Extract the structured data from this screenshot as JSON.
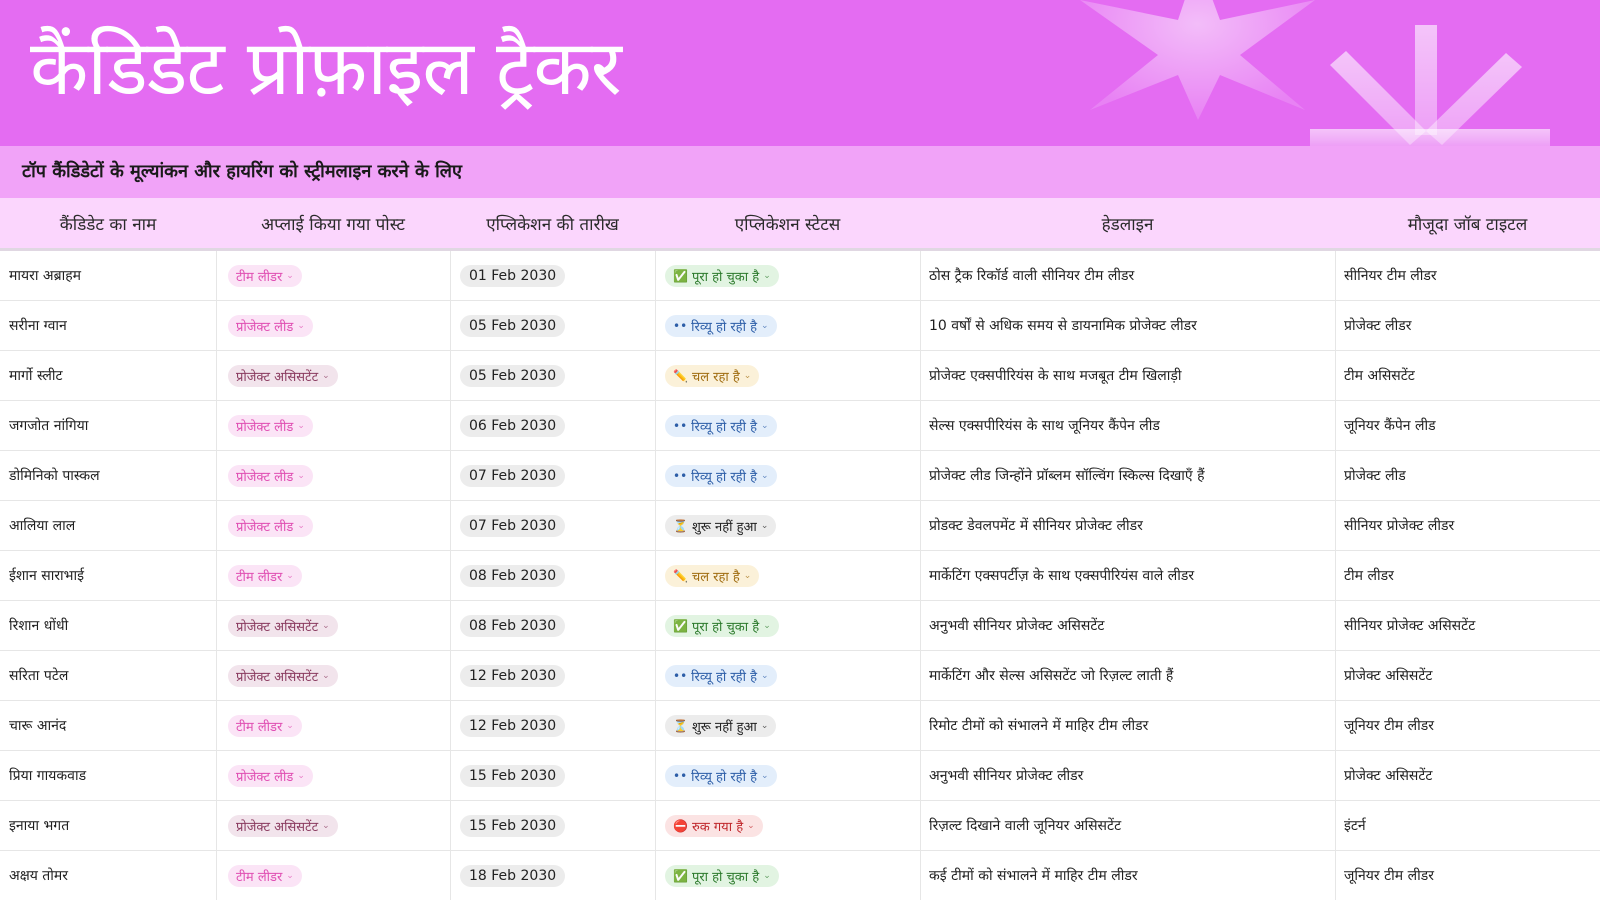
{
  "header": {
    "title": "कैंडिडेट प्रोफ़ाइल ट्रैकर",
    "subtitle": "टॉप कैंडिडेटों के मूल्यांकन और हायरिंग को स्ट्रीमलाइन करने के लिए"
  },
  "colors": {
    "banner": "#e46cf2",
    "subtitle_bar": "#f1a3f8",
    "header_row": "#fbd6fd"
  },
  "columns": [
    "कैंडिडेट का नाम",
    "अप्लाई किया गया पोस्ट",
    "एप्लिकेशन की तारीख",
    "एप्लिकेशन स्टेटस",
    "हेडलाइन",
    "मौजूदा जॉब टाइटल"
  ],
  "status_icons": {
    "done": "check-icon",
    "review": "eyes-icon",
    "progress": "pencil-icon",
    "notstarted": "hourglass-icon",
    "stopped": "no-entry-icon"
  },
  "rows": [
    {
      "name": "मायरा अब्राहम",
      "post": "टीम लीडर",
      "post_type": "team",
      "date": "01 Feb 2030",
      "status": "पूरा हो चुका है",
      "status_type": "done",
      "headline": "ठोस ट्रैक रिकॉर्ड वाली सीनियर टीम लीडर",
      "title": "सीनियर टीम लीडर"
    },
    {
      "name": "सरीना ग्वान",
      "post": "प्रोजेक्ट लीड",
      "post_type": "lead",
      "date": "05 Feb 2030",
      "status": "रिव्यू हो रही है",
      "status_type": "review",
      "headline": "10 वर्षों से अधिक समय से डायनामिक प्रोजेक्ट लीडर",
      "title": "प्रोजेक्ट लीडर"
    },
    {
      "name": "मार्गो स्लीट",
      "post": "प्रोजेक्ट असिसटेंट",
      "post_type": "assist",
      "date": "05 Feb 2030",
      "status": "चल रहा है",
      "status_type": "progress",
      "headline": "प्रोजेक्ट एक्सपीरियंस के साथ मजबूत टीम खिलाड़ी",
      "title": "टीम असिसटेंट"
    },
    {
      "name": "जगजोत नांगिया",
      "post": "प्रोजेक्ट लीड",
      "post_type": "lead",
      "date": "06 Feb 2030",
      "status": "रिव्यू हो रही है",
      "status_type": "review",
      "headline": "सेल्स एक्सपीरियंस के साथ जूनियर कैंपेन लीड",
      "title": "जूनियर कैंपेन लीड"
    },
    {
      "name": "डोमिनिको पास्कल",
      "post": "प्रोजेक्ट लीड",
      "post_type": "lead",
      "date": "07 Feb 2030",
      "status": "रिव्यू हो रही है",
      "status_type": "review",
      "headline": "प्रोजेक्ट लीड जिन्होंने प्रॉब्लम सॉल्विंग स्किल्स दिखाएँ हैं",
      "title": "प्रोजेक्ट लीड"
    },
    {
      "name": "आलिया लाल",
      "post": "प्रोजेक्ट लीड",
      "post_type": "lead",
      "date": "07 Feb 2030",
      "status": "शुरू नहीं हुआ",
      "status_type": "notstarted",
      "headline": "प्रोडक्ट डेवलपमेंट में सीनियर प्रोजेक्ट लीडर",
      "title": "सीनियर प्रोजेक्ट लीडर"
    },
    {
      "name": "ईशान साराभाई",
      "post": "टीम लीडर",
      "post_type": "team",
      "date": "08 Feb 2030",
      "status": "चल रहा है",
      "status_type": "progress",
      "headline": "मार्केटिंग एक्सपर्टीज़ के साथ एक्सपीरियंस वाले लीडर",
      "title": "टीम लीडर"
    },
    {
      "name": "रिशान धोंधी",
      "post": "प्रोजेक्ट असिसटेंट",
      "post_type": "assist",
      "date": "08 Feb 2030",
      "status": "पूरा हो चुका है",
      "status_type": "done",
      "headline": "अनुभवी सीनियर प्रोजेक्ट असिसटेंट",
      "title": "सीनियर प्रोजेक्ट असिसटेंट"
    },
    {
      "name": "सरिता पटेल",
      "post": "प्रोजेक्ट असिसटेंट",
      "post_type": "assist",
      "date": "12 Feb 2030",
      "status": "रिव्यू हो रही है",
      "status_type": "review",
      "headline": "मार्केटिंग और सेल्स असिसटेंट जो रिज़ल्ट लाती हैं",
      "title": "प्रोजेक्ट असिसटेंट"
    },
    {
      "name": "चारू आनंद",
      "post": "टीम लीडर",
      "post_type": "team",
      "date": "12 Feb 2030",
      "status": "शुरू नहीं हुआ",
      "status_type": "notstarted",
      "headline": "रिमोट टीमों को संभालने में माहिर टीम लीडर",
      "title": "जूनियर टीम लीडर"
    },
    {
      "name": "प्रिया गायकवाड",
      "post": "प्रोजेक्ट लीड",
      "post_type": "lead",
      "date": "15 Feb 2030",
      "status": "रिव्यू हो रही है",
      "status_type": "review",
      "headline": "अनुभवी सीनियर प्रोजेक्ट लीडर",
      "title": "प्रोजेक्ट असिसटेंट"
    },
    {
      "name": "इनाया भगत",
      "post": "प्रोजेक्ट असिसटेंट",
      "post_type": "assist",
      "date": "15 Feb 2030",
      "status": "रुक गया है",
      "status_type": "stopped",
      "headline": "रिज़ल्ट दिखाने वाली जूनियर असिसटेंट",
      "title": "इंटर्न"
    },
    {
      "name": "अक्षय तोमर",
      "post": "टीम लीडर",
      "post_type": "team",
      "date": "18 Feb 2030",
      "status": "पूरा हो चुका है",
      "status_type": "done",
      "headline": "कई टीमों को संभालने में माहिर टीम लीडर",
      "title": "जूनियर टीम लीडर"
    }
  ]
}
